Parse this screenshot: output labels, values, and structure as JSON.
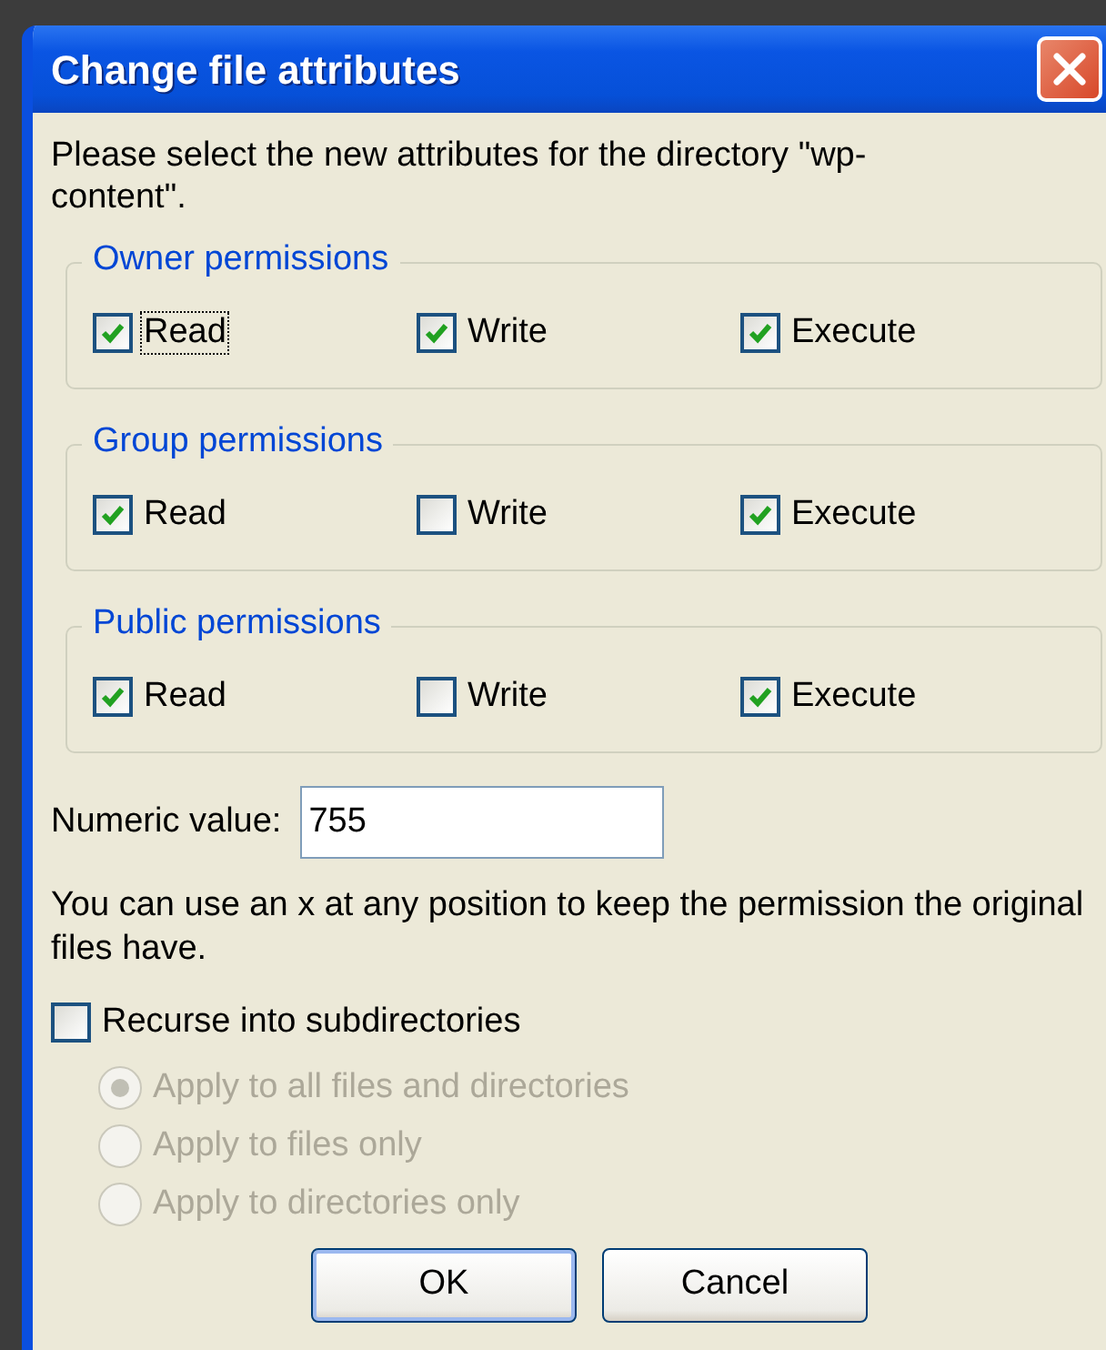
{
  "window": {
    "title": "Change file attributes"
  },
  "intro": "Please select the new attributes for the directory \"wp-content\".",
  "groups": [
    {
      "title": "Owner permissions",
      "options": [
        {
          "label": "Read",
          "checked": true,
          "focused": true
        },
        {
          "label": "Write",
          "checked": true,
          "focused": false
        },
        {
          "label": "Execute",
          "checked": true,
          "focused": false
        }
      ]
    },
    {
      "title": "Group permissions",
      "options": [
        {
          "label": "Read",
          "checked": true,
          "focused": false
        },
        {
          "label": "Write",
          "checked": false,
          "focused": false
        },
        {
          "label": "Execute",
          "checked": true,
          "focused": false
        }
      ]
    },
    {
      "title": "Public permissions",
      "options": [
        {
          "label": "Read",
          "checked": true,
          "focused": false
        },
        {
          "label": "Write",
          "checked": false,
          "focused": false
        },
        {
          "label": "Execute",
          "checked": true,
          "focused": false
        }
      ]
    }
  ],
  "numeric": {
    "label": "Numeric value:",
    "value": "755"
  },
  "note": "You can use an x at any position to keep the permission the original files have.",
  "recurse": {
    "label": "Recurse into subdirectories",
    "checked": false
  },
  "apply_options": [
    {
      "label": "Apply to all files and directories",
      "selected": true,
      "disabled": true
    },
    {
      "label": "Apply to files only",
      "selected": false,
      "disabled": true
    },
    {
      "label": "Apply to directories only",
      "selected": false,
      "disabled": true
    }
  ],
  "buttons": [
    {
      "label": "OK",
      "default": true
    },
    {
      "label": "Cancel",
      "default": false
    }
  ]
}
